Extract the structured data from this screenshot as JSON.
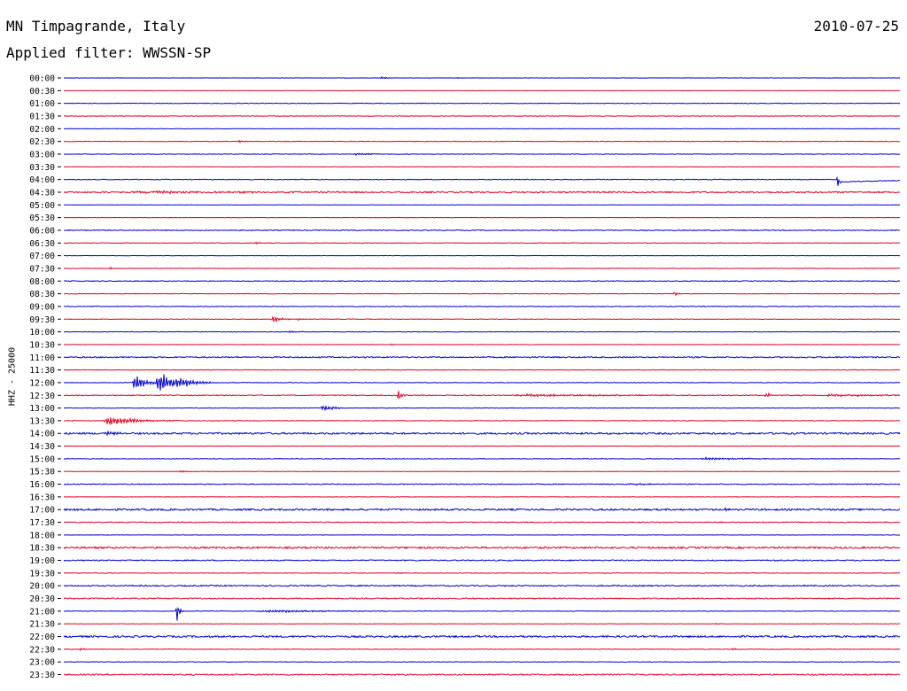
{
  "header": {
    "title": "MN Timpagrande, Italy",
    "date": "2010-07-25",
    "filter": "Applied filter: WWSSN-SP"
  },
  "chart_data": {
    "type": "line",
    "title": "MN Timpagrande, Italy",
    "ylabel": "HHZ - 25000",
    "colors": [
      "#0000cc",
      "#dd0022"
    ],
    "rows": [
      {
        "label": "00:00",
        "noise": 0.15,
        "events": [
          {
            "x": 0.38,
            "amp": 1.5,
            "width": 0.008
          },
          {
            "x": 0.47,
            "amp": 1,
            "width": 0.004
          }
        ]
      },
      {
        "label": "00:30",
        "noise": 0.15,
        "events": []
      },
      {
        "label": "01:00",
        "noise": 0.35,
        "events": []
      },
      {
        "label": "01:30",
        "noise": 0.3,
        "events": []
      },
      {
        "label": "02:00",
        "noise": 0.2,
        "events": []
      },
      {
        "label": "02:30",
        "noise": 0.3,
        "events": [
          {
            "x": 0.21,
            "amp": 1.5,
            "width": 0.008
          }
        ]
      },
      {
        "label": "03:00",
        "noise": 0.3,
        "events": [
          {
            "x": 0.35,
            "amp": 1.5,
            "width": 0.02
          }
        ]
      },
      {
        "label": "03:30",
        "noise": 0.2,
        "events": []
      },
      {
        "label": "04:00",
        "noise": 0.4,
        "events": [
          {
            "x": 0.925,
            "amp": 9,
            "width": 0.002,
            "shift": 3
          }
        ]
      },
      {
        "label": "04:30",
        "noise": 0.8,
        "events": [
          {
            "x": 0.1,
            "amp": 1.2,
            "width": 0.12
          }
        ]
      },
      {
        "label": "05:00",
        "noise": 0.15,
        "events": []
      },
      {
        "label": "05:30",
        "noise": 0.2,
        "events": []
      },
      {
        "label": "06:00",
        "noise": 0.45,
        "events": []
      },
      {
        "label": "06:30",
        "noise": 0.3,
        "events": [
          {
            "x": 0.23,
            "amp": 1.5,
            "width": 0.008
          }
        ]
      },
      {
        "label": "07:00",
        "noise": 0.15,
        "events": []
      },
      {
        "label": "07:30",
        "noise": 0.25,
        "events": [
          {
            "x": 0.055,
            "amp": 1.5,
            "width": 0.006
          }
        ]
      },
      {
        "label": "08:00",
        "noise": 0.45,
        "events": []
      },
      {
        "label": "08:30",
        "noise": 0.3,
        "events": [
          {
            "x": 0.73,
            "amp": 3,
            "width": 0.004
          }
        ]
      },
      {
        "label": "09:00",
        "noise": 0.4,
        "events": []
      },
      {
        "label": "09:30",
        "noise": 0.3,
        "events": [
          {
            "x": 0.25,
            "amp": 5,
            "width": 0.008
          },
          {
            "x": 0.28,
            "amp": 1.5,
            "width": 0.008
          }
        ]
      },
      {
        "label": "10:00",
        "noise": 0.3,
        "events": [
          {
            "x": 0.27,
            "amp": 1.5,
            "width": 0.008
          }
        ]
      },
      {
        "label": "10:30",
        "noise": 0.2,
        "events": [
          {
            "x": 0.39,
            "amp": 1.2,
            "width": 0.006
          }
        ]
      },
      {
        "label": "11:00",
        "noise": 0.7,
        "events": []
      },
      {
        "label": "11:30",
        "noise": 0.3,
        "events": []
      },
      {
        "label": "12:00",
        "noise": 0.3,
        "events": [
          {
            "x": 0.085,
            "amp": 11,
            "width": 0.012
          },
          {
            "x": 0.115,
            "amp": 13,
            "width": 0.02
          },
          {
            "x": 0.14,
            "amp": 2,
            "width": 0.03
          }
        ]
      },
      {
        "label": "12:30",
        "noise": 0.5,
        "events": [
          {
            "x": 0.4,
            "amp": 10,
            "width": 0.003
          },
          {
            "x": 0.56,
            "amp": 1.5,
            "width": 0.1
          },
          {
            "x": 0.84,
            "amp": 4,
            "width": 0.005
          },
          {
            "x": 0.92,
            "amp": 1.5,
            "width": 0.06
          }
        ]
      },
      {
        "label": "13:00",
        "noise": 0.3,
        "events": [
          {
            "x": 0.31,
            "amp": 4,
            "width": 0.012
          }
        ]
      },
      {
        "label": "13:30",
        "noise": 0.3,
        "events": [
          {
            "x": 0.055,
            "amp": 6,
            "width": 0.03
          }
        ]
      },
      {
        "label": "14:00",
        "noise": 1.0,
        "events": [
          {
            "x": 0.05,
            "amp": 2.5,
            "width": 0.01
          }
        ]
      },
      {
        "label": "14:30",
        "noise": 0.2,
        "events": []
      },
      {
        "label": "15:00",
        "noise": 0.3,
        "events": [
          {
            "x": 0.77,
            "amp": 1.5,
            "width": 0.05
          }
        ]
      },
      {
        "label": "15:30",
        "noise": 0.2,
        "events": [
          {
            "x": 0.14,
            "amp": 2,
            "width": 0.006
          }
        ]
      },
      {
        "label": "16:00",
        "noise": 0.5,
        "events": [
          {
            "x": 0.68,
            "amp": 1.2,
            "width": 0.02
          }
        ]
      },
      {
        "label": "16:30",
        "noise": 0.2,
        "events": []
      },
      {
        "label": "17:00",
        "noise": 1.0,
        "events": [
          {
            "x": 0.79,
            "amp": 2,
            "width": 0.006
          }
        ]
      },
      {
        "label": "17:30",
        "noise": 0.5,
        "events": []
      },
      {
        "label": "18:00",
        "noise": 0.2,
        "events": []
      },
      {
        "label": "18:30",
        "noise": 1.0,
        "events": []
      },
      {
        "label": "19:00",
        "noise": 0.6,
        "events": [
          {
            "x": 0.85,
            "amp": 2,
            "width": 0.004
          }
        ]
      },
      {
        "label": "19:30",
        "noise": 0.3,
        "events": [
          {
            "x": 0.4,
            "amp": 1.5,
            "width": 0.004
          }
        ]
      },
      {
        "label": "20:00",
        "noise": 0.7,
        "events": []
      },
      {
        "label": "20:30",
        "noise": 0.6,
        "events": []
      },
      {
        "label": "21:00",
        "noise": 0.3,
        "events": [
          {
            "x": 0.135,
            "amp": 14,
            "width": 0.003
          },
          {
            "x": 0.25,
            "amp": 1.5,
            "width": 0.08
          }
        ]
      },
      {
        "label": "21:30",
        "noise": 0.2,
        "events": [
          {
            "x": 0.78,
            "amp": 1.2,
            "width": 0.004
          }
        ]
      },
      {
        "label": "22:00",
        "noise": 1.0,
        "events": []
      },
      {
        "label": "22:30",
        "noise": 0.3,
        "events": [
          {
            "x": 0.02,
            "amp": 2,
            "width": 0.004
          },
          {
            "x": 0.8,
            "amp": 2,
            "width": 0.004
          }
        ]
      },
      {
        "label": "23:00",
        "noise": 0.3,
        "events": []
      },
      {
        "label": "23:30",
        "noise": 0.7,
        "events": []
      }
    ]
  }
}
